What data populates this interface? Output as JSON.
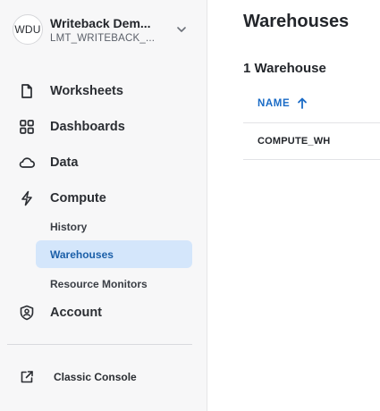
{
  "account": {
    "avatar_text": "WDU",
    "name": "Writeback Dem...",
    "id": "LMT_WRITEBACK_..."
  },
  "nav": {
    "worksheets": "Worksheets",
    "dashboards": "Dashboards",
    "data": "Data",
    "compute": "Compute",
    "compute_sub": [
      "History",
      "Warehouses",
      "Resource Monitors"
    ],
    "account": "Account",
    "classic_console": "Classic Console"
  },
  "main": {
    "title": "Warehouses",
    "count_label": "1 Warehouse",
    "table": {
      "column_name": "NAME",
      "sort": "ascending",
      "rows": [
        {
          "name": "COMPUTE_WH"
        }
      ]
    }
  },
  "colors": {
    "accent": "#1a6bc6",
    "active_bg": "#d4e6fb",
    "sidebar_bg": "#f7f7f8"
  }
}
